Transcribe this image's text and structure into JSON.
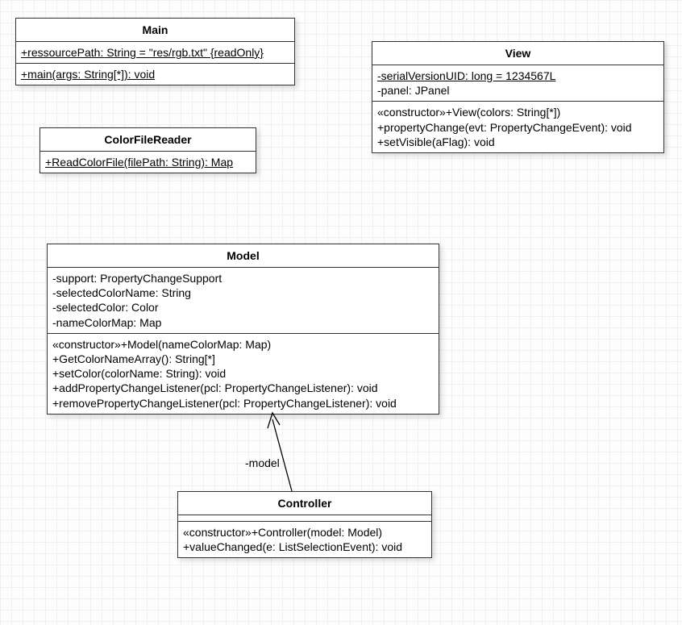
{
  "classes": {
    "main": {
      "name": "Main",
      "attrs": [
        "+ressourcePath: String = \"res/rgb.txt\" {readOnly}"
      ],
      "ops": [
        "+main(args: String[*]): void"
      ]
    },
    "colorFileReader": {
      "name": "ColorFileReader",
      "ops": [
        "+ReadColorFile(filePath: String): Map"
      ]
    },
    "view": {
      "name": "View",
      "attrs": [
        "-serialVersionUID: long = 1234567L",
        "-panel: JPanel"
      ],
      "ops": [
        "«constructor»+View(colors: String[*])",
        "+propertyChange(evt: PropertyChangeEvent): void",
        "+setVisible(aFlag): void"
      ]
    },
    "model": {
      "name": "Model",
      "attrs": [
        "-support: PropertyChangeSupport",
        "-selectedColorName: String",
        "-selectedColor: Color",
        "-nameColorMap: Map"
      ],
      "ops": [
        "«constructor»+Model(nameColorMap: Map)",
        "+GetColorNameArray(): String[*]",
        "+setColor(colorName: String): void",
        "+addPropertyChangeListener(pcl: PropertyChangeListener): void",
        "+removePropertyChangeListener(pcl: PropertyChangeListener): void"
      ]
    },
    "controller": {
      "name": "Controller",
      "ops": [
        "«constructor»+Controller(model: Model)",
        "+valueChanged(e: ListSelectionEvent): void"
      ]
    }
  },
  "association": {
    "label": "-model"
  }
}
